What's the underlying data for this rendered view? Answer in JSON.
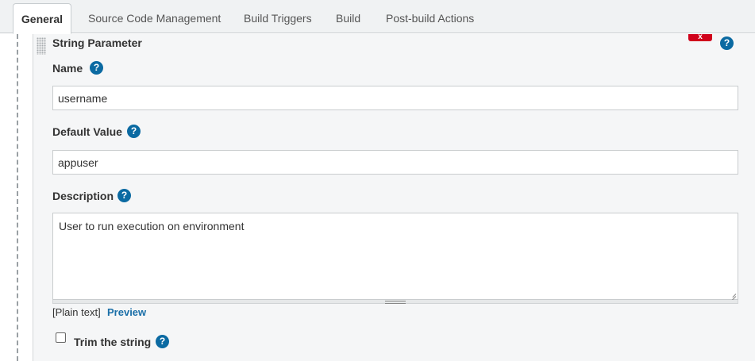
{
  "tabs": [
    {
      "label": "General",
      "active": true
    },
    {
      "label": "Source Code Management"
    },
    {
      "label": "Build Triggers"
    },
    {
      "label": "Build"
    },
    {
      "label": "Post-build Actions"
    }
  ],
  "param": {
    "title": "String Parameter",
    "delete_label": "x",
    "name_label": "Name",
    "name_value": "username",
    "default_label": "Default Value",
    "default_value": "appuser",
    "description_label": "Description",
    "description_value": "User to run execution on environment",
    "format_text": "[Plain text]",
    "preview_label": "Preview",
    "trim_label": "Trim the string",
    "help_glyph": "?"
  },
  "colors": {
    "help": "#0b6aa2",
    "delete": "#d0021b",
    "link": "#1a6fa8"
  }
}
